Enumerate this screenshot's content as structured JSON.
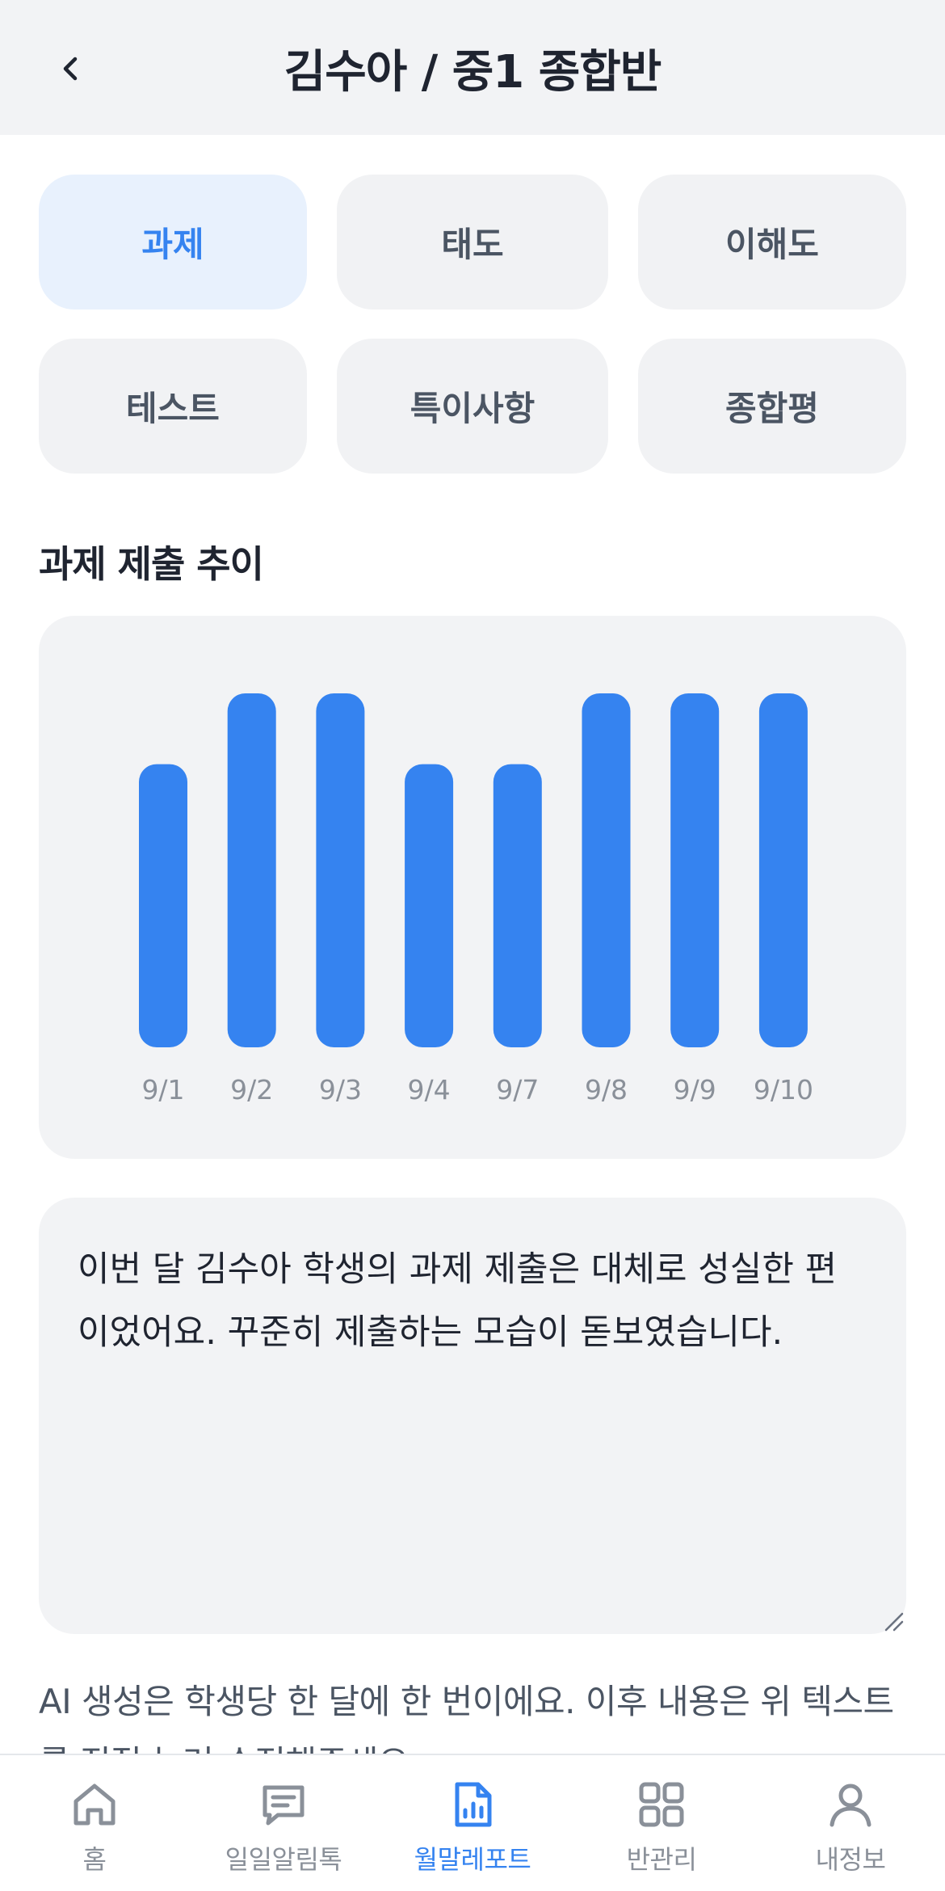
{
  "header": {
    "title": "김수아 / 중1 종합반"
  },
  "tabs": [
    {
      "label": "과제",
      "active": true
    },
    {
      "label": "태도",
      "active": false
    },
    {
      "label": "이해도",
      "active": false
    },
    {
      "label": "테스트",
      "active": false
    },
    {
      "label": "특이사항",
      "active": false
    },
    {
      "label": "종합평",
      "active": false
    }
  ],
  "section": {
    "title": "과제 제출 추이"
  },
  "chart_data": {
    "type": "bar",
    "categories": [
      "9/1",
      "9/2",
      "9/3",
      "9/4",
      "9/7",
      "9/8",
      "9/9",
      "9/10"
    ],
    "values": [
      80,
      100,
      100,
      80,
      80,
      100,
      100,
      100
    ],
    "ylim": [
      0,
      100
    ],
    "bar_color": "#3583f0",
    "grid": false,
    "title": "",
    "xlabel": "",
    "ylabel": ""
  },
  "comment": {
    "value": "이번 달 김수아 학생의 과제 제출은 대체로 성실한 편이었어요. 꾸준히 제출하는 모습이 돋보였습니다."
  },
  "note": {
    "text": "AI 생성은 학생당 한 달에 한 번이에요. 이후 내용은 위 텍스트를 직접 눌러 수정해주세요."
  },
  "bottom_nav": [
    {
      "label": "홈",
      "icon": "home-icon",
      "active": false
    },
    {
      "label": "일일알림톡",
      "icon": "message-icon",
      "active": false
    },
    {
      "label": "월말레포트",
      "icon": "report-icon",
      "active": true
    },
    {
      "label": "반관리",
      "icon": "grid-icon",
      "active": false
    },
    {
      "label": "내정보",
      "icon": "user-icon",
      "active": false
    }
  ],
  "colors": {
    "accent": "#3583f0",
    "tab_active_bg": "#e8f1fd",
    "card_bg": "#f2f3f5",
    "muted_text": "#8a9099"
  }
}
